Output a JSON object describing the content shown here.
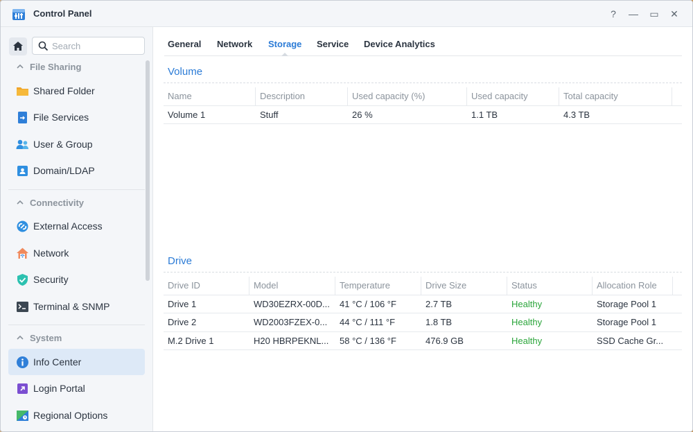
{
  "window": {
    "title": "Control Panel",
    "help_label": "?",
    "minimize_label": "—",
    "maximize_label": "▭",
    "close_label": "✕"
  },
  "search": {
    "placeholder": "Search",
    "value": ""
  },
  "sidebar": {
    "sections": [
      {
        "title": "File Sharing",
        "items": [
          {
            "label": "Shared Folder",
            "icon": "folder-icon"
          },
          {
            "label": "File Services",
            "icon": "file-services-icon"
          },
          {
            "label": "User & Group",
            "icon": "users-icon"
          },
          {
            "label": "Domain/LDAP",
            "icon": "domain-icon"
          }
        ]
      },
      {
        "title": "Connectivity",
        "items": [
          {
            "label": "External Access",
            "icon": "external-access-icon"
          },
          {
            "label": "Network",
            "icon": "network-house-icon"
          },
          {
            "label": "Security",
            "icon": "shield-icon"
          },
          {
            "label": "Terminal & SNMP",
            "icon": "terminal-icon"
          }
        ]
      },
      {
        "title": "System",
        "items": [
          {
            "label": "Info Center",
            "icon": "info-icon",
            "active": true
          },
          {
            "label": "Login Portal",
            "icon": "login-portal-icon"
          },
          {
            "label": "Regional Options",
            "icon": "regional-icon"
          }
        ]
      }
    ]
  },
  "tabs": [
    {
      "label": "General"
    },
    {
      "label": "Network"
    },
    {
      "label": "Storage",
      "active": true
    },
    {
      "label": "Service"
    },
    {
      "label": "Device Analytics"
    }
  ],
  "volume": {
    "title": "Volume",
    "columns": [
      "Name",
      "Description",
      "Used capacity (%)",
      "Used capacity",
      "Total capacity"
    ],
    "rows": [
      [
        "Volume 1",
        "Stuff",
        "26 %",
        "1.1 TB",
        "4.3 TB"
      ]
    ]
  },
  "drive": {
    "title": "Drive",
    "columns": [
      "Drive ID",
      "Model",
      "Temperature",
      "Drive Size",
      "Status",
      "Allocation Role"
    ],
    "rows": [
      [
        "Drive 1",
        "WD30EZRX-00D...",
        "41 °C / 106 °F",
        "2.7 TB",
        "Healthy",
        "Storage Pool 1"
      ],
      [
        "Drive 2",
        "WD2003FZEX-0...",
        "44 °C / 111 °F",
        "1.8 TB",
        "Healthy",
        "Storage Pool 1"
      ],
      [
        "M.2 Drive 1",
        "H20 HBRPEKNL...",
        "58 °C / 136 °F",
        "476.9 GB",
        "Healthy",
        "SSD Cache Gr..."
      ]
    ]
  },
  "colors": {
    "accent": "#2b7bd6",
    "healthy": "#2aa53a",
    "active_bg": "#dde9f7"
  }
}
